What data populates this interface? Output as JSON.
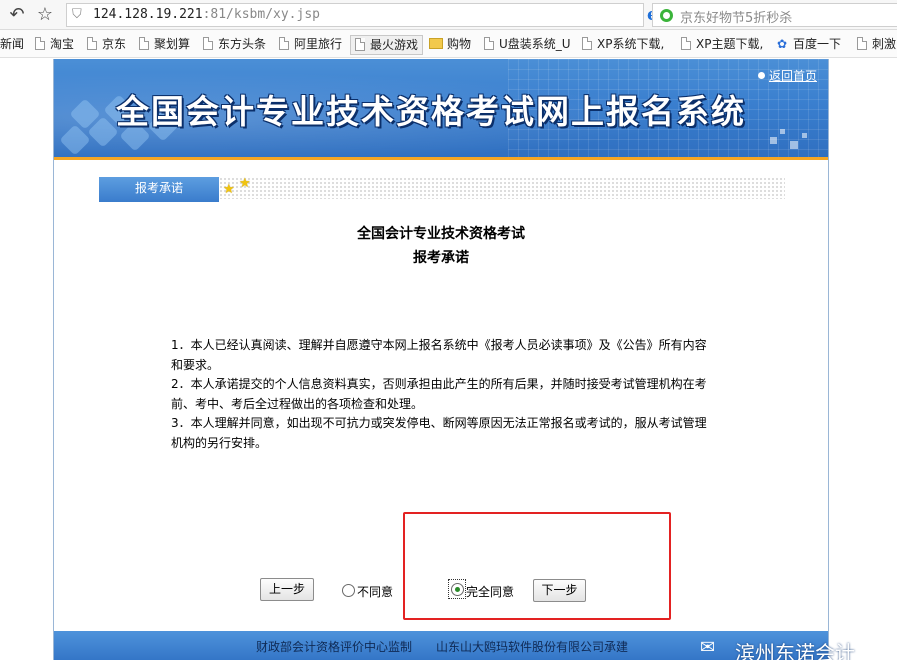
{
  "browser": {
    "url_host": "124.128.19.221",
    "url_path": ":81/ksbm/xy.jsp",
    "search_placeholder": "京东好物节5折秒杀",
    "bookmarks": [
      "新闻",
      "淘宝",
      "京东",
      "聚划算",
      "东方头条",
      "阿里旅行",
      "最火游戏",
      "购物",
      "U盘装系统_U",
      "XP系统下载,",
      "XP主题下载,",
      "百度一下",
      "刺激"
    ]
  },
  "header": {
    "title": "全国会计专业技术资格考试网上报名系统",
    "return_link": "返回首页"
  },
  "tab": {
    "label": "报考承诺"
  },
  "doc": {
    "title": "全国会计专业技术资格考试",
    "subtitle": "报考承诺",
    "terms": [
      "1．本人已经认真阅读、理解并自愿遵守本网上报名系统中《报考人员必读事项》及《公告》所有内容和要求。",
      "2．本人承诺提交的个人信息资料真实，否则承担由此产生的所有后果，并随时接受考试管理机构在考前、考中、考后全过程做出的各项检查和处理。",
      "3．本人理解并同意，如出现不可抗力或突发停电、断网等原因无法正常报名或考试的，服从考试管理机构的另行安排。"
    ]
  },
  "form": {
    "prev_label": "上一步",
    "disagree_label": "不同意",
    "agree_label": "完全同意",
    "next_label": "下一步",
    "selected": "agree"
  },
  "footer": {
    "supervisor": "财政部会计资格评价中心监制",
    "undertaker": "山东山大鸥玛软件股份有限公司承建"
  },
  "watermark": {
    "text": "滨州东诺会计"
  },
  "colors": {
    "banner": "#3a7fcf",
    "accent_line": "#f5a623",
    "highlight": "#e32222",
    "footer": "#4e93db"
  }
}
